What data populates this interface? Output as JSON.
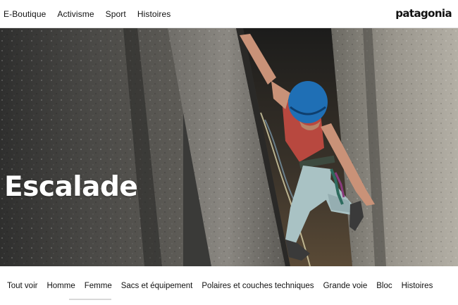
{
  "topnav": {
    "items": [
      {
        "label": "E-Boutique"
      },
      {
        "label": "Activisme"
      },
      {
        "label": "Sport"
      },
      {
        "label": "Histoires"
      }
    ],
    "brand": "patagonia"
  },
  "hero": {
    "title": "Escalade",
    "image": "rock-climber-in-crack"
  },
  "categories": {
    "items": [
      {
        "label": "Tout voir"
      },
      {
        "label": "Homme"
      },
      {
        "label": "Femme"
      },
      {
        "label": "Sacs et équipement"
      },
      {
        "label": "Polaires et couches techniques"
      },
      {
        "label": "Grande voie"
      },
      {
        "label": "Bloc"
      },
      {
        "label": "Histoires"
      }
    ]
  },
  "colors": {
    "helmet": "#1f6fb5",
    "pants": "#a9c2c4",
    "top": "#b8483f",
    "rock_dark": "#3a3a38",
    "rock_light": "#8a8780"
  }
}
